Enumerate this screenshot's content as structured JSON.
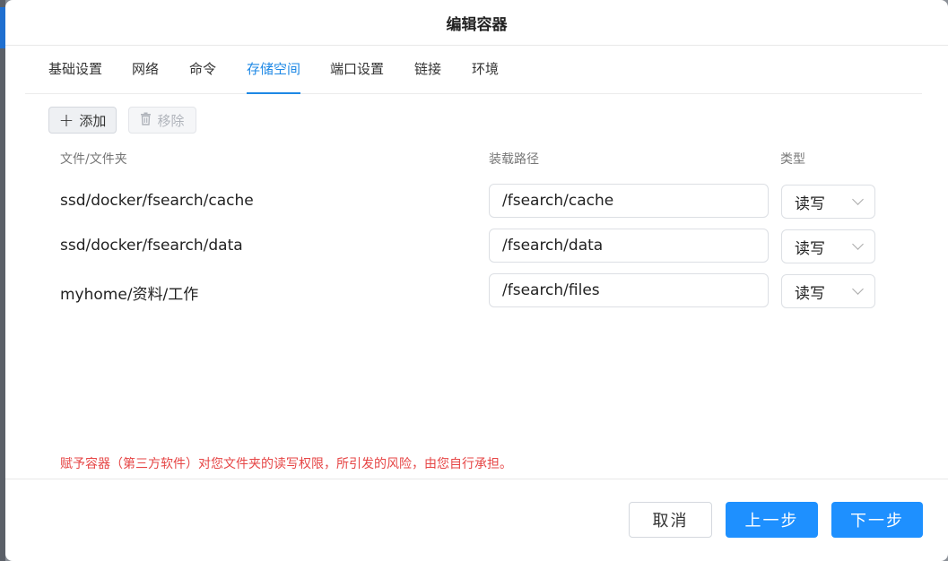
{
  "dialog": {
    "title": "编辑容器"
  },
  "tabs": [
    {
      "label": "基础设置"
    },
    {
      "label": "网络"
    },
    {
      "label": "命令"
    },
    {
      "label": "存储空间",
      "active": true
    },
    {
      "label": "端口设置"
    },
    {
      "label": "链接"
    },
    {
      "label": "环境"
    }
  ],
  "toolbar": {
    "add_label": "添加",
    "remove_label": "移除",
    "add_icon": "plus-icon",
    "remove_icon": "trash-icon"
  },
  "columns": {
    "host": "文件/文件夹",
    "mount": "装载路径",
    "type": "类型"
  },
  "rows": [
    {
      "host": "ssd/docker/fsearch/cache",
      "mount": "/fsearch/cache",
      "type": "读写"
    },
    {
      "host": "ssd/docker/fsearch/data",
      "mount": "/fsearch/data",
      "type": "读写"
    },
    {
      "host": "myhome/资料/工作",
      "mount": "/fsearch/files",
      "type": "读写"
    }
  ],
  "warning": "赋予容器（第三方软件）对您文件夹的读写权限，所引发的风险，由您自行承担。",
  "footer": {
    "cancel_label": "取消",
    "prev_label": "上一步",
    "next_label": "下一步"
  },
  "colors": {
    "accent": "#1e90ff",
    "warning": "#e64545"
  }
}
